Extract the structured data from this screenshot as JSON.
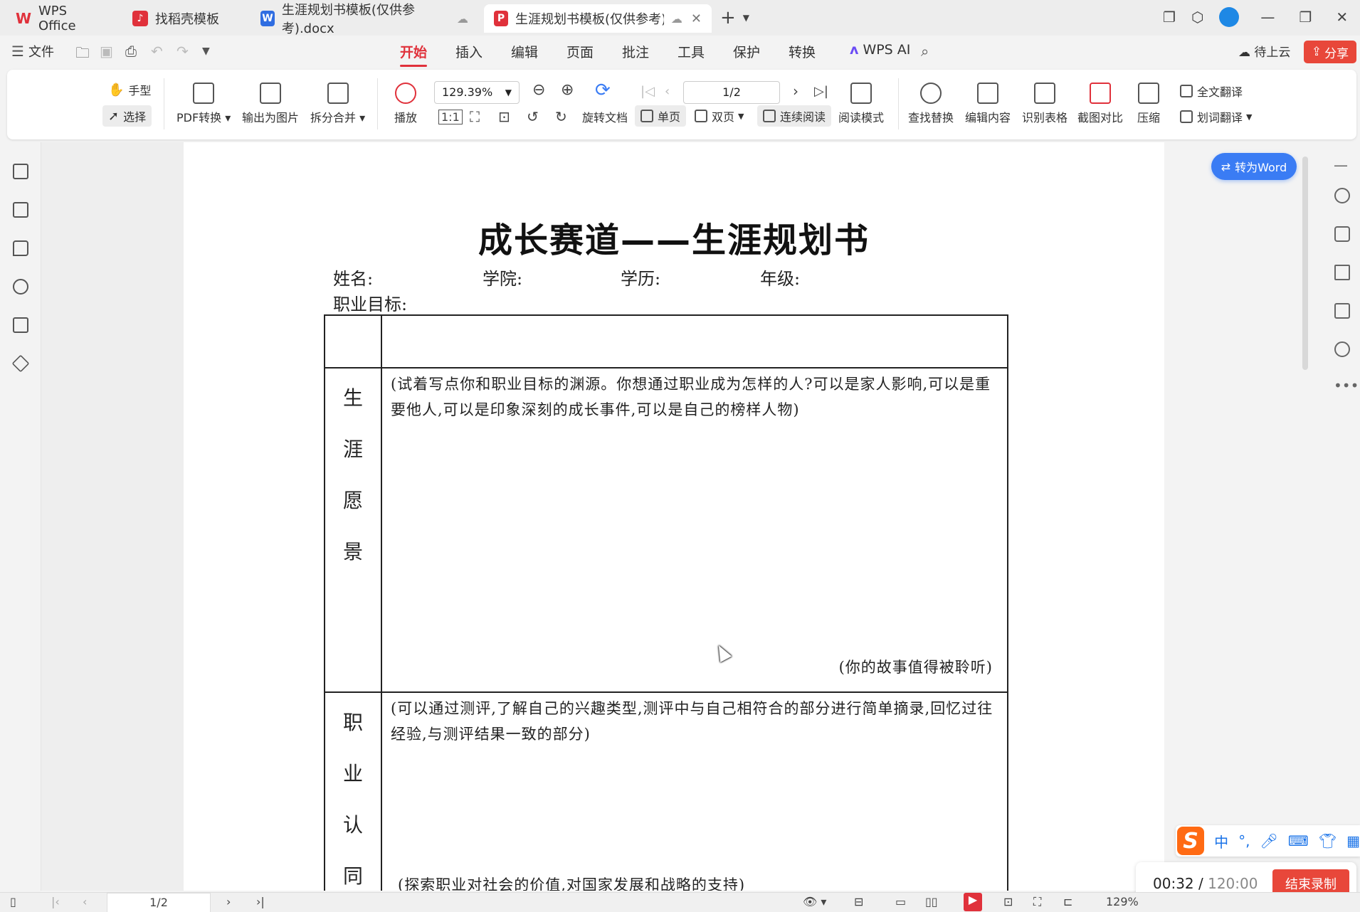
{
  "tabs": [
    {
      "label": "WPS Office"
    },
    {
      "label": "找稻壳模板"
    },
    {
      "label": "生涯规划书模板(仅供参考).docx"
    },
    {
      "label": "生涯规划书模板(仅供参考).p"
    }
  ],
  "menu": {
    "file": "文件",
    "tabs": [
      "开始",
      "插入",
      "编辑",
      "页面",
      "批注",
      "工具",
      "保护",
      "转换"
    ],
    "wps_ai": "WPS AI",
    "cloud_status": "待上云",
    "share": "分享"
  },
  "ribbon": {
    "hand": "手型",
    "select": "选择",
    "pdf_convert": "PDF转换",
    "export_image": "输出为图片",
    "split_merge": "拆分合并",
    "play": "播放",
    "zoom": "129.39%",
    "page": "1/2",
    "rotate_doc": "旋转文档",
    "single_page": "单页",
    "double_page": "双页",
    "continuous": "连续阅读",
    "read_mode": "阅读模式",
    "find_replace": "查找替换",
    "edit_content": "编辑内容",
    "recognize_table": "识别表格",
    "screenshot_compare": "截图对比",
    "compress": "压缩",
    "full_translate": "全文翻译",
    "word_translate": "划词翻译"
  },
  "doc": {
    "title": "成长赛道——生涯规划书",
    "name_label": "姓名:",
    "college_label": "学院:",
    "degree_label": "学历:",
    "grade_label": "年级:",
    "goal_label": "职业目标:",
    "sections": [
      {
        "label": [
          "生",
          "涯",
          "愿",
          "景"
        ],
        "hint": "(试着写点你和职业目标的渊源。你想通过职业成为怎样的人?可以是家人影响,可以是重要他人,可以是印象深刻的成长事件,可以是自己的榜样人物)",
        "footer": "(你的故事值得被聆听)"
      },
      {
        "label": [
          "职",
          "业",
          "认",
          "同"
        ],
        "hint": "(可以通过测评,了解自己的兴趣类型,测评中与自己相符合的部分进行简单摘录,回忆过往经验,与测评结果一致的部分)",
        "footer": "(探索职业对社会的价值,对国家发展和战略的支持)"
      }
    ]
  },
  "to_word": "转为Word",
  "status": {
    "page": "1/2",
    "zoom": "129%"
  },
  "recorder": {
    "elapsed": "00:32",
    "total": "120:00",
    "stop": "结束录制"
  },
  "ime": {
    "mode": "中",
    "punct": "°,"
  }
}
